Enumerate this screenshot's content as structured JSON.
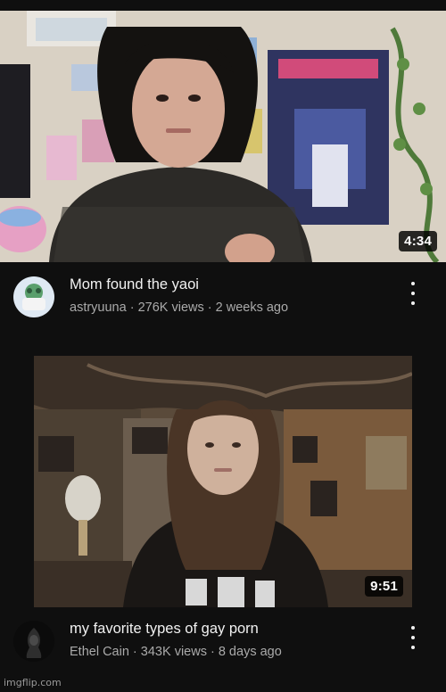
{
  "feed": {
    "videos": [
      {
        "title": "Mom found the yaoi",
        "channel": "astryuuna",
        "views": "276K views",
        "age": "2 weeks ago",
        "duration": "4:34"
      },
      {
        "title": "my favorite types of gay porn",
        "channel": "Ethel Cain",
        "views": "343K views",
        "age": "8 days ago",
        "duration": "9:51"
      }
    ],
    "separator": " · "
  },
  "watermark": "imgflip.com",
  "icons": {
    "menu": "more-vert-icon",
    "avatar": "channel-avatar"
  },
  "colors": {
    "background": "#0f0f0f",
    "primary_text": "#f1f1f1",
    "secondary_text": "#aaaaaa"
  }
}
